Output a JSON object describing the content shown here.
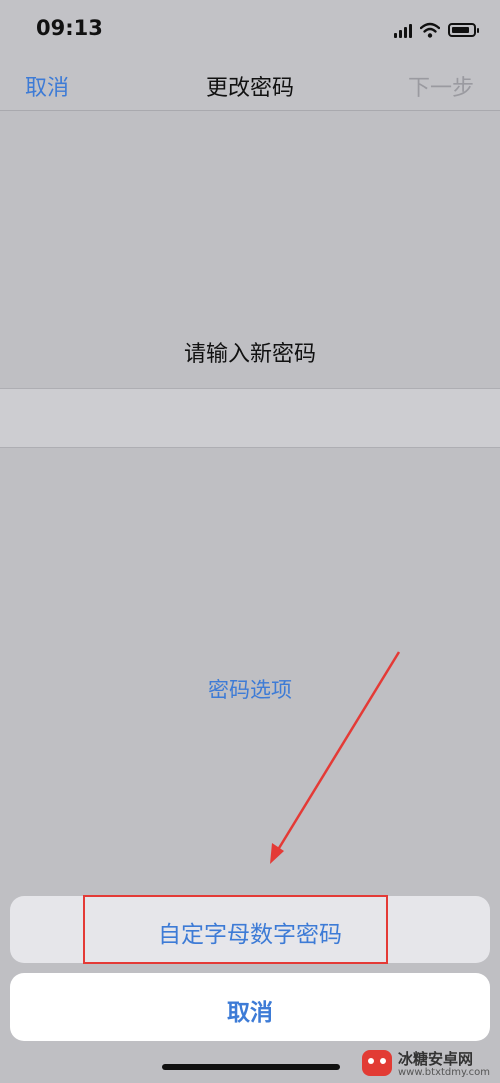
{
  "status_bar": {
    "time": "09:13",
    "icons": [
      "signal-icon",
      "wifi-icon",
      "battery-icon"
    ]
  },
  "nav": {
    "cancel_label": "取消",
    "title": "更改密码",
    "next_label": "下一步"
  },
  "main": {
    "prompt": "请输入新密码",
    "options_link": "密码选项"
  },
  "action_sheet": {
    "option_label": "自定字母数字密码",
    "cancel_label": "取消"
  },
  "watermark": {
    "title": "冰糖安卓网",
    "url": "www.btxtdmy.com"
  },
  "colors": {
    "accent": "#3d7bd6",
    "disabled": "#9a9aa0",
    "annotation": "#e43a36",
    "background": "#bfbfc3"
  }
}
